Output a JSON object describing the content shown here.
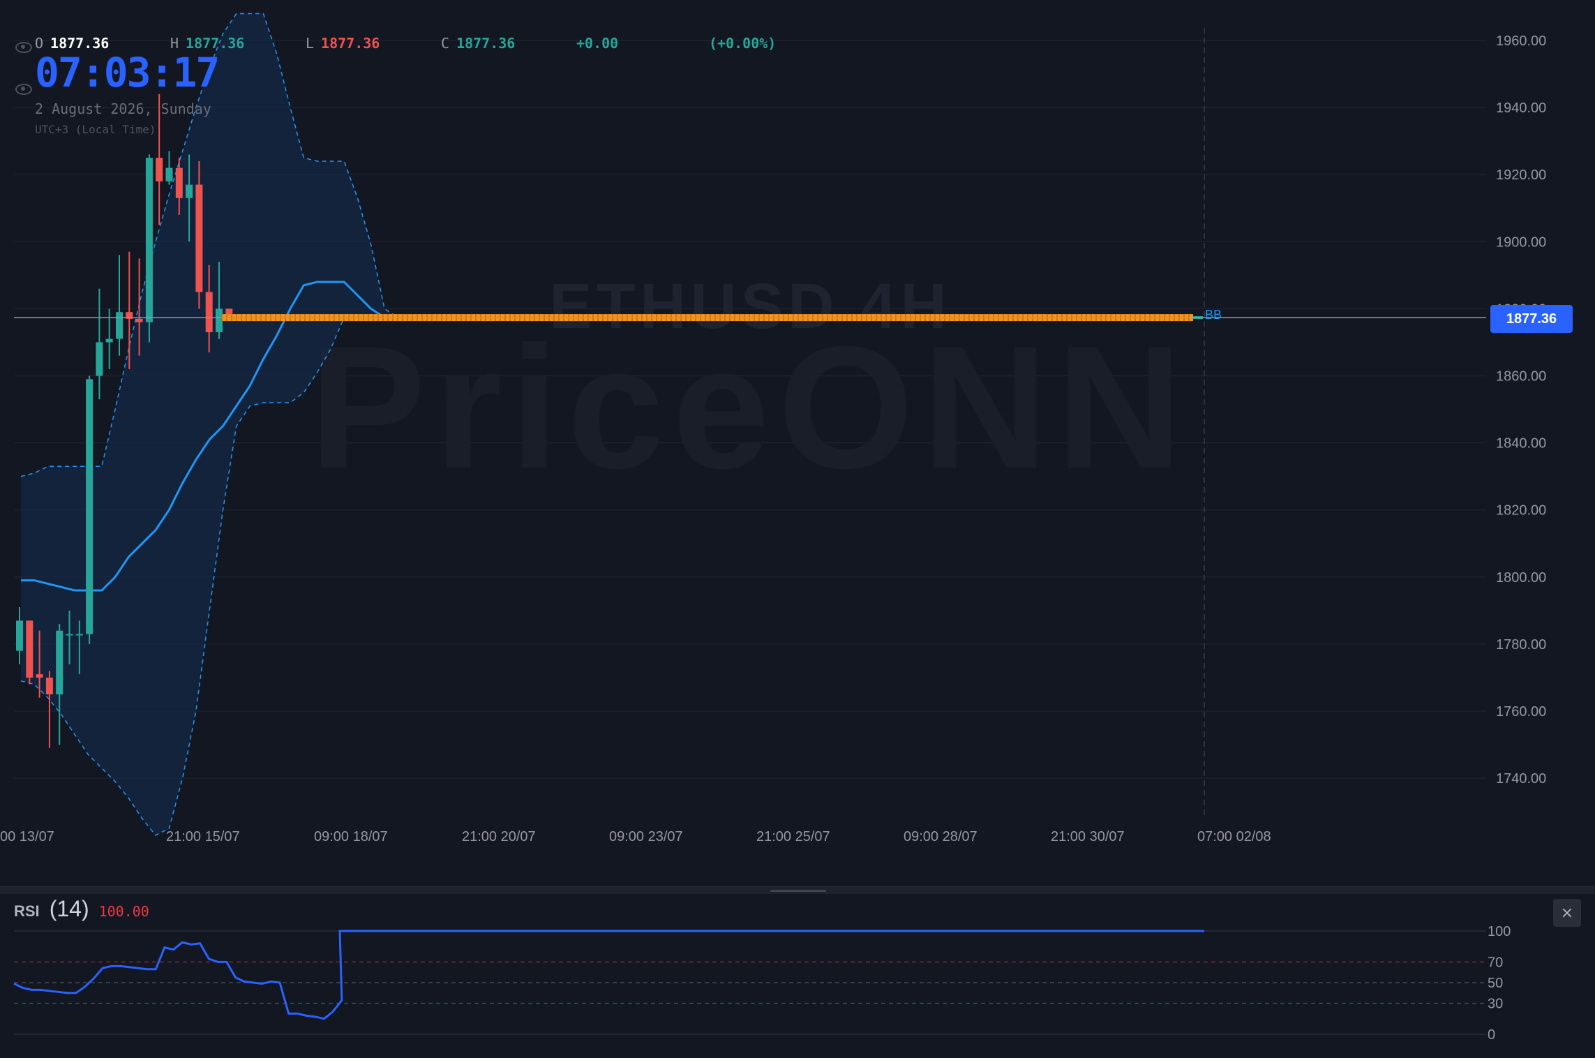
{
  "legend": {
    "o_label": "O",
    "o_value": "1877.36",
    "h_label": "H",
    "h_value": "1877.36",
    "l_label": "L",
    "l_value": "1877.36",
    "c_label": "C",
    "c_value": "1877.36",
    "change": "+0.00",
    "change_pct": "(+0.00%)"
  },
  "clock": {
    "time": "07:03:17",
    "date": "2 August 2026, Sunday",
    "timezone": "UTC+3 (Local Time)"
  },
  "watermark": {
    "symbol": "ETHUSD 4H",
    "brand": "PriceONN"
  },
  "last_price": "1877.36",
  "bb_label": "BB",
  "rsi": {
    "name": "RSI",
    "period": "(14)",
    "value": "100.00",
    "close_icon": "close-icon",
    "close_glyph": "×"
  },
  "colors": {
    "up": "#26a69a",
    "down": "#ef5350",
    "bb_mid": "#2196f3",
    "rsi": "#2962ff",
    "accent": "#2962ff",
    "flat_bars": "#f7931a"
  },
  "chart_data": [
    {
      "type": "candlestick",
      "x_tick_labels": [
        "00 13/07",
        "21:00 15/07",
        "09:00 18/07",
        "21:00 20/07",
        "09:00 23/07",
        "21:00 25/07",
        "09:00 28/07",
        "21:00 30/07",
        "07:00 02/08"
      ],
      "y_tick_labels": [
        "1960.00",
        "1940.00",
        "1920.00",
        "1900.00",
        "1880.00",
        "1860.00",
        "1840.00",
        "1820.00",
        "1800.00",
        "1780.00",
        "1760.00",
        "1740.00"
      ],
      "ylim": [
        1734,
        1968
      ],
      "candles": [
        [
          1778,
          1787,
          1774,
          1791
        ],
        [
          1787,
          1770,
          1768,
          1787
        ],
        [
          1771,
          1770,
          1764,
          1784
        ],
        [
          1770,
          1765,
          1749,
          1772
        ],
        [
          1765,
          1784,
          1750,
          1786
        ],
        [
          1783,
          1783,
          1774,
          1790
        ],
        [
          1783,
          1783,
          1771,
          1787
        ],
        [
          1783,
          1859,
          1780,
          1860
        ],
        [
          1860,
          1870,
          1853,
          1886
        ],
        [
          1870,
          1871,
          1862,
          1880
        ],
        [
          1871,
          1879,
          1866,
          1896
        ],
        [
          1879,
          1877,
          1862,
          1897
        ],
        [
          1877,
          1876,
          1866,
          1895
        ],
        [
          1876,
          1925,
          1870,
          1926
        ],
        [
          1925,
          1918,
          1905,
          1944
        ],
        [
          1918,
          1922,
          1917,
          1927
        ],
        [
          1922,
          1913,
          1908,
          1925
        ],
        [
          1913,
          1917,
          1900,
          1926
        ],
        [
          1917,
          1885,
          1880,
          1924
        ],
        [
          1885,
          1873,
          1867,
          1893
        ],
        [
          1873,
          1880,
          1871,
          1894
        ],
        [
          1880,
          1877.36,
          1877,
          1880
        ]
      ],
      "flat_series": {
        "value": 1877.36,
        "from": "22:00 16/07",
        "to": "07:00 02/08",
        "color": "orange"
      },
      "bollinger": {
        "label": "BB",
        "upper": [
          1830,
          1831,
          1833,
          1833,
          1833,
          1833,
          1833,
          1850,
          1868,
          1885,
          1900,
          1914,
          1927,
          1940,
          1952,
          1962,
          1968,
          1968,
          1968,
          1956,
          1940,
          1925,
          1924,
          1924,
          1924,
          1913,
          1899,
          1880,
          1877.4
        ],
        "middle": [
          1799,
          1799,
          1798,
          1797,
          1796,
          1796,
          1796,
          1800,
          1806,
          1810,
          1814,
          1820,
          1828,
          1835,
          1841,
          1845,
          1851,
          1857,
          1865,
          1872,
          1880,
          1887,
          1888,
          1888,
          1888,
          1884,
          1880,
          1877.4,
          1877.4
        ],
        "lower": [
          1769,
          1768,
          1764,
          1759,
          1753,
          1747,
          1743,
          1739,
          1734,
          1728,
          1723,
          1725,
          1740,
          1760,
          1790,
          1820,
          1845,
          1851,
          1852,
          1852,
          1852,
          1855,
          1861,
          1868,
          1877.4,
          1877.4,
          1877.4,
          1877.4,
          1877.4
        ]
      },
      "last_price": 1877.36,
      "grid": true
    },
    {
      "type": "line",
      "name": "RSI",
      "ylim": [
        0,
        100
      ],
      "y_tick_labels": [
        "100",
        "70",
        "50",
        "30",
        "0"
      ],
      "levels": [
        70,
        50,
        30
      ],
      "values": [
        49,
        45,
        43,
        43,
        42,
        41,
        40,
        40,
        46,
        54,
        64,
        66,
        66,
        65,
        64,
        63,
        63,
        84,
        82,
        89,
        87,
        88,
        73,
        70,
        70,
        55,
        51,
        50,
        49,
        51,
        50,
        20,
        20,
        18,
        17,
        15,
        22,
        33,
        100,
        100
      ]
    }
  ]
}
